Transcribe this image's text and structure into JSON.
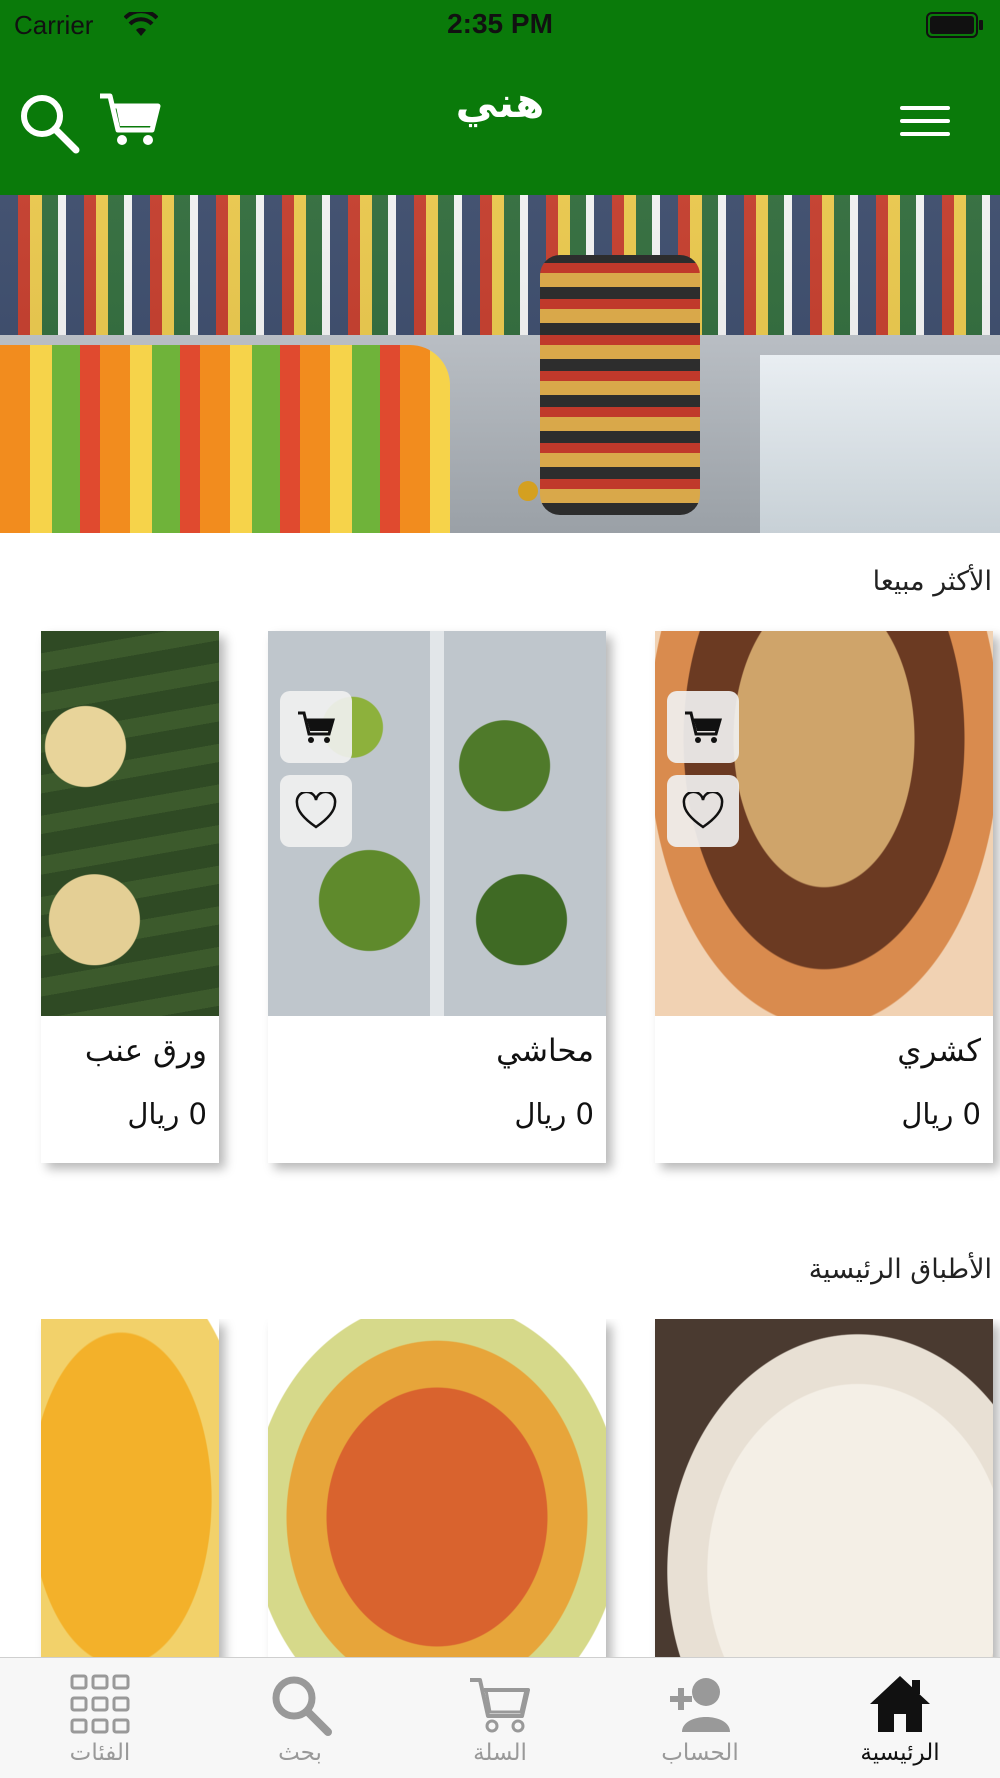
{
  "status_bar": {
    "carrier": "Carrier",
    "time": "2:35 PM"
  },
  "header": {
    "title": "هني"
  },
  "banner": {
    "dots": 1
  },
  "sections": [
    {
      "title": "الأكثر مبيعا",
      "items": [
        {
          "name": "كشري",
          "price": "0 ريال"
        },
        {
          "name": "محاشي",
          "price": "0 ريال"
        },
        {
          "name": "ورق عنب",
          "price": "0 ريال"
        }
      ]
    },
    {
      "title": "الأطباق الرئيسية",
      "items": [
        {
          "name": "",
          "price": ""
        },
        {
          "name": "",
          "price": ""
        },
        {
          "name": "",
          "price": ""
        }
      ]
    }
  ],
  "tab_bar": {
    "items": [
      {
        "label": "الرئيسية",
        "icon": "home-icon",
        "active": true
      },
      {
        "label": "الحساب",
        "icon": "add-user-icon",
        "active": false
      },
      {
        "label": "السلة",
        "icon": "cart-icon",
        "active": false
      },
      {
        "label": "بحث",
        "icon": "search-icon",
        "active": false
      },
      {
        "label": "الفئات",
        "icon": "grid-icon",
        "active": false
      }
    ]
  },
  "colors": {
    "brand_green": "#0a7a0a",
    "tab_inactive": "#999999",
    "tab_active": "#111111",
    "banner_dot": "#d4a020"
  }
}
